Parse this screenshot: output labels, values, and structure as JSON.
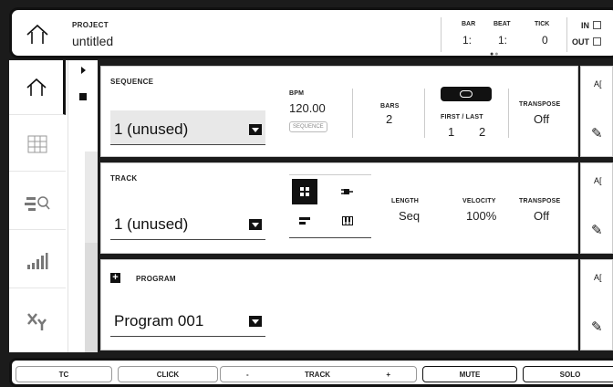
{
  "header": {
    "project_label": "PROJECT",
    "project_name": "untitled",
    "bar_label": "BAR",
    "beat_label": "BEAT",
    "tick_label": "TICK",
    "bar_value": "1:",
    "beat_value": "1:",
    "tick_value": "0",
    "in_label": "IN",
    "out_label": "OUT"
  },
  "sidebar": {
    "items": [
      {
        "icon": "home-icon"
      },
      {
        "icon": "grid-icon"
      },
      {
        "icon": "browse-icon"
      },
      {
        "icon": "levels-icon"
      },
      {
        "icon": "xy-icon"
      }
    ]
  },
  "sequence": {
    "title": "SEQUENCE",
    "selected": "1  (unused)",
    "bpm_label": "BPM",
    "bpm_value": "120.00",
    "sequence_button": "SEQUENCE",
    "bars_label": "BARS",
    "bars_value": "2",
    "first_last_label": "FIRST / LAST",
    "first_value": "1",
    "last_value": "2",
    "transpose_label": "TRANSPOSE",
    "transpose_value": "Off"
  },
  "track": {
    "title": "TRACK",
    "selected": "1  (unused)",
    "length_label": "LENGTH",
    "length_value": "Seq",
    "velocity_label": "VELOCITY",
    "velocity_value": "100%",
    "transpose_label": "TRANSPOSE",
    "transpose_value": "Off"
  },
  "program": {
    "title": "PROGRAM",
    "selected": "Program 001"
  },
  "bottom": {
    "tc": "TC",
    "click": "CLICK",
    "minus": "-",
    "track": "TRACK",
    "plus": "+",
    "mute": "MUTE",
    "solo": "SOLO"
  },
  "side_icons": {
    "a_label": "A",
    "pencil": "✎"
  }
}
